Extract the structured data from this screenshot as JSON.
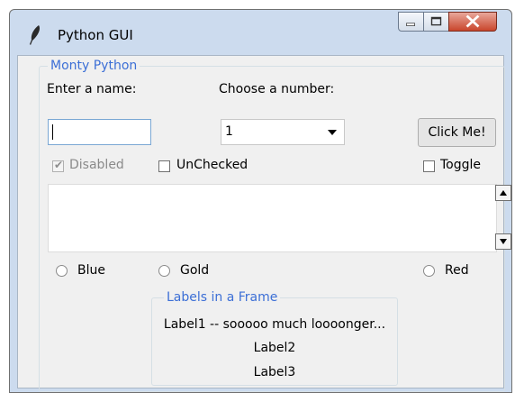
{
  "window": {
    "title": "Python GUI"
  },
  "group": {
    "title": "Monty Python",
    "name_label": "Enter a name:",
    "name_value": "",
    "number_label": "Choose a number:",
    "number_value": "1",
    "click_button": "Click Me!",
    "checks": [
      {
        "label": "Disabled",
        "checked": true,
        "enabled": false
      },
      {
        "label": "UnChecked",
        "checked": false,
        "enabled": true
      },
      {
        "label": "Toggle",
        "checked": false,
        "enabled": true
      }
    ],
    "text_area_value": "",
    "radios": [
      {
        "label": "Blue",
        "selected": false
      },
      {
        "label": "Gold",
        "selected": false
      },
      {
        "label": "Red",
        "selected": false
      }
    ]
  },
  "labels_frame": {
    "title": "Labels in a Frame",
    "labels": [
      "Label1 -- sooooo much loooonger...",
      "Label2",
      "Label3"
    ]
  }
}
